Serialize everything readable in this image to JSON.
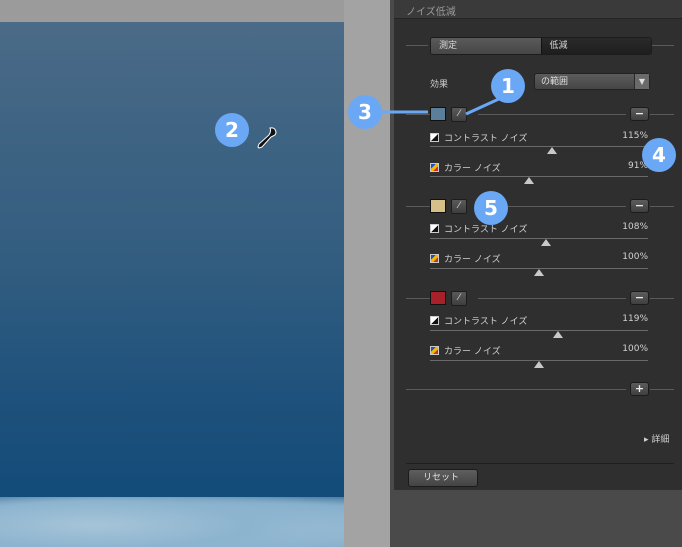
{
  "panel": {
    "title": "ノイズ低減",
    "mode_tabs": [
      "測定",
      "低減"
    ],
    "effect_label": "効果",
    "effect_value": "の範囲",
    "contrast_label": "コントラスト ノイズ",
    "color_label": "カラー ノイズ",
    "groups": [
      {
        "swatch": "#5b7f9a",
        "contrast_pct": "115%",
        "contrast": 1.15,
        "color_pct": "91%",
        "color": 0.91
      },
      {
        "swatch": "#d6c08a",
        "contrast_pct": "108%",
        "contrast": 1.08,
        "color_pct": "100%",
        "color": 1.0
      },
      {
        "swatch": "#a8202a",
        "contrast_pct": "119%",
        "contrast": 1.19,
        "color_pct": "100%",
        "color": 1.0
      }
    ],
    "add_glyph": "+",
    "remove_glyph": "−",
    "detail": "詳細",
    "reset": "リセット"
  },
  "callouts": [
    "1",
    "2",
    "3",
    "4",
    "5"
  ],
  "colors": {
    "accent": "#6aa8f5",
    "panel": "#2f2f2f"
  },
  "icons": {
    "picker": "eyedropper-icon",
    "contrast": "contrast-icon",
    "color": "color-noise-icon"
  }
}
